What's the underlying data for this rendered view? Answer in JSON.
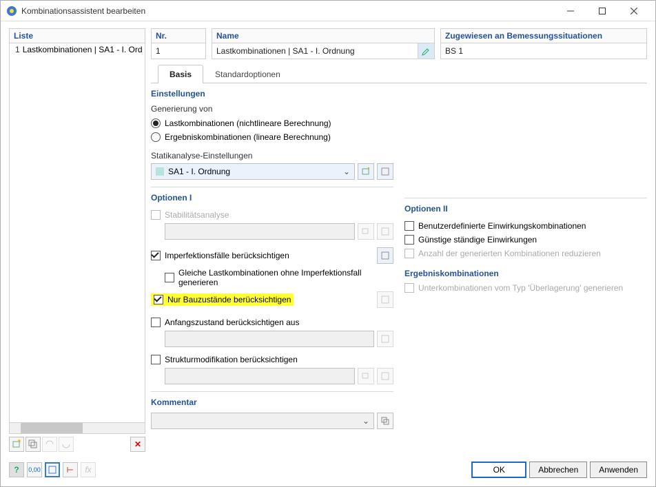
{
  "window": {
    "title": "Kombinationsassistent bearbeiten"
  },
  "left": {
    "header": "Liste",
    "items": [
      {
        "num": "1",
        "label": "Lastkombinationen | SA1 - I. Ord"
      }
    ]
  },
  "nr": {
    "label": "Nr.",
    "value": "1"
  },
  "name": {
    "label": "Name",
    "value": "Lastkombinationen | SA1 - I. Ordnung"
  },
  "bs": {
    "label": "Zugewiesen an Bemessungssituationen",
    "value": "BS 1"
  },
  "tabs": {
    "basis": "Basis",
    "standard": "Standardoptionen"
  },
  "settings": {
    "title": "Einstellungen",
    "gen_label": "Generierung von",
    "radio1": "Lastkombinationen (nichtlineare Berechnung)",
    "radio2": "Ergebniskombinationen (lineare Berechnung)",
    "static_label": "Statikanalyse-Einstellungen",
    "static_value": "SA1 - I. Ordnung"
  },
  "opt1": {
    "title": "Optionen I",
    "stability": "Stabilitätsanalyse",
    "imperfection": "Imperfektionsfälle berücksichtigen",
    "same_combo": "Gleiche Lastkombinationen ohne Imperfektionsfall generieren",
    "bauzustande": "Nur Bauzustände berücksichtigen",
    "initial": "Anfangszustand berücksichtigen aus",
    "structmod": "Strukturmodifikation berücksichtigen"
  },
  "opt2": {
    "title": "Optionen II",
    "user_combo": "Benutzerdefinierte Einwirkungskombinationen",
    "favorable": "Günstige ständige Einwirkungen",
    "reduce": "Anzahl der generierten Kombinationen reduzieren",
    "result_title": "Ergebniskombinationen",
    "subcombo": "Unterkombinationen vom Typ 'Überlagerung' generieren"
  },
  "comment": {
    "title": "Kommentar"
  },
  "buttons": {
    "ok": "OK",
    "cancel": "Abbrechen",
    "apply": "Anwenden"
  }
}
